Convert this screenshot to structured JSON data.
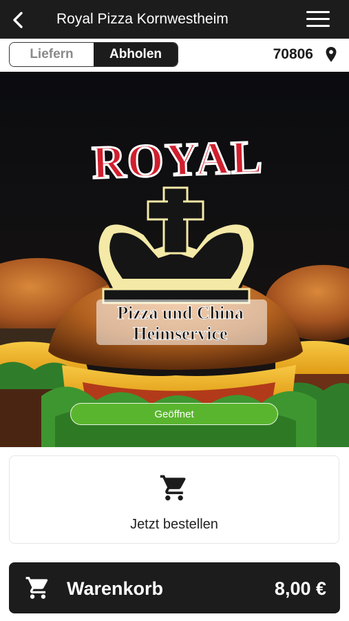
{
  "header": {
    "title": "Royal Pizza Kornwestheim"
  },
  "mode_toggle": {
    "options": [
      "Liefern",
      "Abholen"
    ],
    "selected": "Abholen"
  },
  "location": {
    "zip": "70806"
  },
  "hero": {
    "logo_text": "ROYAL",
    "logo_sub1": "Pizza und China",
    "logo_sub2": "Heimservice",
    "status": "Geöffnet"
  },
  "order": {
    "label": "Jetzt bestellen"
  },
  "cart": {
    "label": "Warenkorb",
    "total": "8,00 €"
  },
  "colors": {
    "bar": "#1c1c1c",
    "status_green": "#5ab52e",
    "logo_red": "#d01f2e"
  }
}
